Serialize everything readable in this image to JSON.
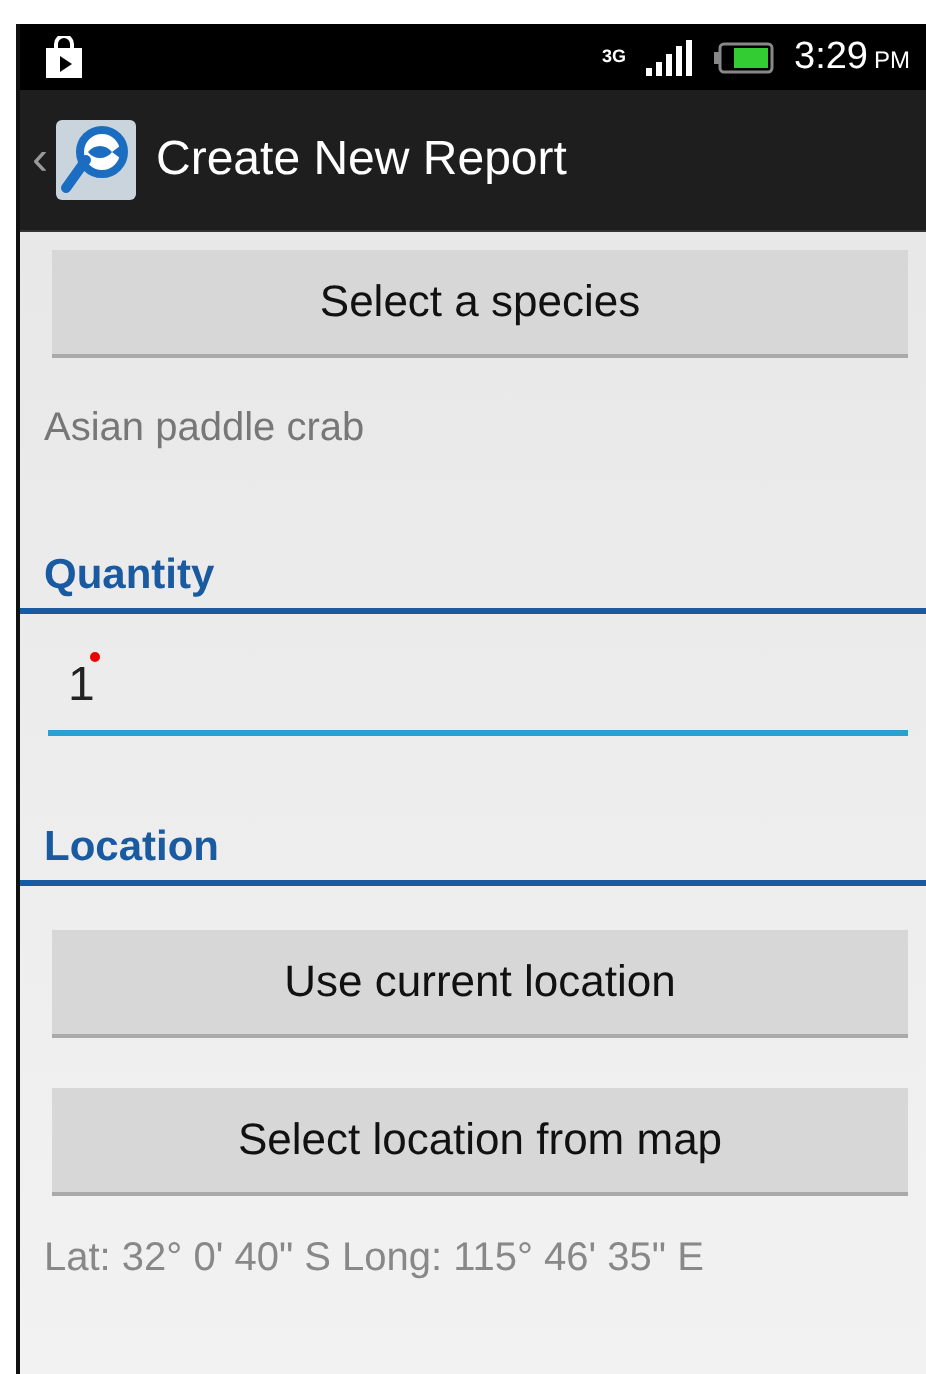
{
  "status_bar": {
    "network": "3G",
    "time": "3:29",
    "time_suffix": "PM"
  },
  "action_bar": {
    "back": "‹",
    "title": "Create New Report"
  },
  "species": {
    "button": "Select a species",
    "value": "Asian paddle crab"
  },
  "quantity": {
    "header": "Quantity",
    "value": "1"
  },
  "location": {
    "header": "Location",
    "buttons": [
      "Use current location",
      "Select location from map"
    ],
    "coordinates": "Lat: 32°  0' 40\" S Long: 115°  46' 35\" E"
  }
}
